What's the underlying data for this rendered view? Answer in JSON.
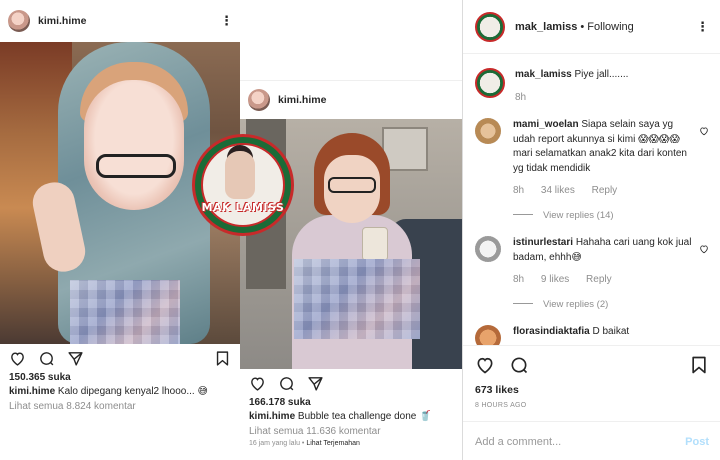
{
  "post1": {
    "username": "kimi.hime",
    "likes": "150.365 suka",
    "caption_user": "kimi.hime",
    "caption_text": "Kalo dipegang kenyal2 lhooo... 😅",
    "view_all": "Lihat semua 8.824 komentar"
  },
  "logo": {
    "text": "MAK LAMISS"
  },
  "post2": {
    "username": "kimi.hime",
    "likes": "166.178 suka",
    "caption_user": "kimi.hime",
    "caption_text": "Bubble tea challenge done 🥤",
    "view_all": "Lihat semua 11.636 komentar",
    "time_ago": "16 jam yang lalu",
    "translate": "Lihat Terjemahan"
  },
  "post3": {
    "username": "mak_lamiss",
    "following": "• Following",
    "comments": [
      {
        "user": "mak_lamiss",
        "text": "Piye jall.......",
        "time": "8h"
      },
      {
        "user": "mami_woelan",
        "text": "Siapa selain saya yg udah report akunnya si kimi 😱😱😱😱 mari selamatkan anak2 kita dari konten yg tidak mendidik",
        "time": "8h",
        "likes": "34 likes",
        "reply": "Reply",
        "view_replies": "View replies (14)"
      },
      {
        "user": "istinurlestari",
        "text": "Hahaha cari uang kok jual badam, ehhh😅",
        "time": "8h",
        "likes": "9 likes",
        "reply": "Reply",
        "view_replies": "View replies (2)"
      },
      {
        "user": "florasindiaktafia",
        "text": "D baikat"
      }
    ],
    "likes": "673 likes",
    "ago": "8 HOURS AGO",
    "add_comment_placeholder": "Add a comment...",
    "post_label": "Post"
  }
}
